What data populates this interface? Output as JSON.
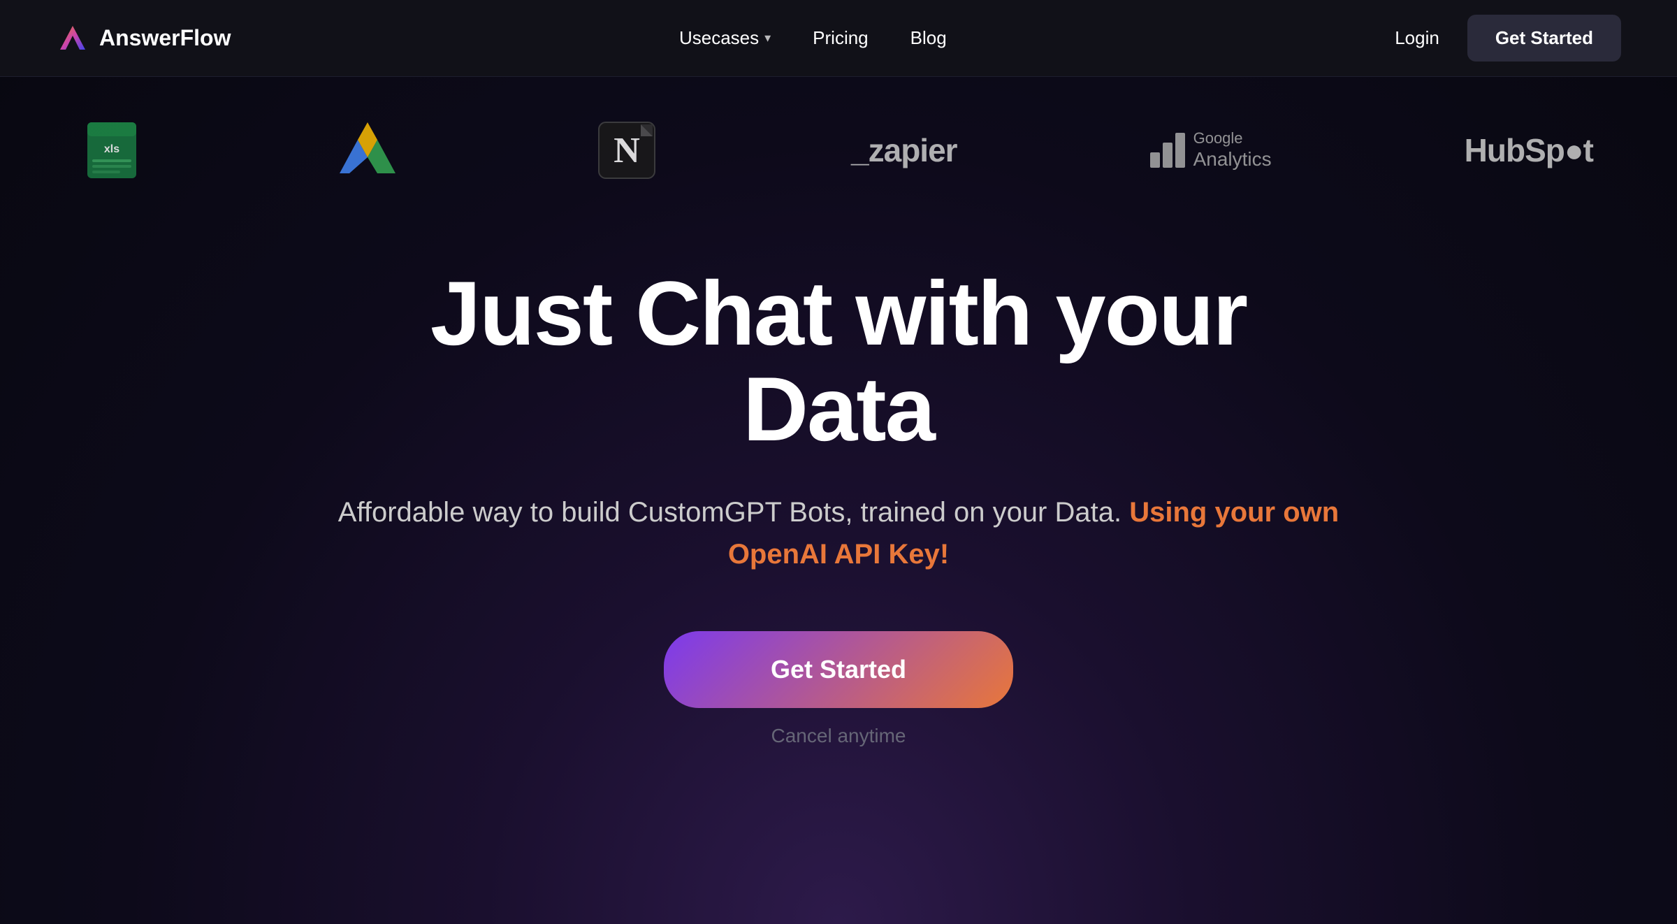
{
  "navbar": {
    "logo_text": "AnswerFlow",
    "nav_items": [
      {
        "label": "Usecases",
        "has_dropdown": true
      },
      {
        "label": "Pricing",
        "has_dropdown": false
      },
      {
        "label": "Blog",
        "has_dropdown": false
      }
    ],
    "login_label": "Login",
    "get_started_label": "Get Started"
  },
  "integrations": [
    {
      "name": "Excel",
      "type": "excel"
    },
    {
      "name": "Google Drive",
      "type": "gdrive"
    },
    {
      "name": "Notion",
      "type": "notion"
    },
    {
      "name": "Zapier",
      "type": "zapier"
    },
    {
      "name": "Google Analytics",
      "type": "google-analytics"
    },
    {
      "name": "HubSpot",
      "type": "hubspot"
    }
  ],
  "hero": {
    "headline": "Just Chat with your Data",
    "subtitle_plain": "Affordable way to build CustomGPT Bots, trained on your Data.",
    "subtitle_highlight": "Using your own\nOpenAI API Key!",
    "cta_label": "Get Started",
    "cancel_label": "Cancel anytime"
  },
  "colors": {
    "accent_orange": "#e8773a",
    "accent_purple": "#7c3aed",
    "nav_bg": "#111118",
    "hero_bg_start": "#2d1a4a",
    "hero_bg_end": "#080810"
  }
}
